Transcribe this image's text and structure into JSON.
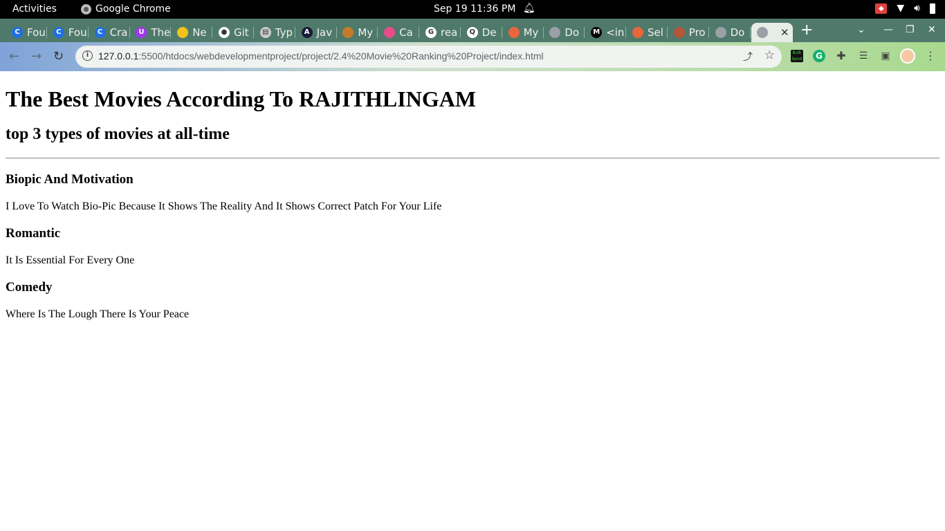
{
  "system_bar": {
    "activities": "Activities",
    "app_name": "Google Chrome",
    "datetime": "Sep 19  11:36 PM"
  },
  "tabs": [
    {
      "label": "Fou",
      "icon": "coursera-icon",
      "color": "#1f6fe5"
    },
    {
      "label": "Fou",
      "icon": "coursera-icon",
      "color": "#1f6fe5"
    },
    {
      "label": "Cra",
      "icon": "coursera-icon",
      "color": "#1f6fe5"
    },
    {
      "label": "The",
      "icon": "udemy-icon",
      "color": "#a435f0"
    },
    {
      "label": "Ne",
      "icon": "site-icon",
      "color": "#f0c419"
    },
    {
      "label": "Git",
      "icon": "github-icon",
      "color": "#ffffff"
    },
    {
      "label": "Typ",
      "icon": "document-icon",
      "color": "#cccccc"
    },
    {
      "label": "Jav",
      "icon": "angular-icon",
      "color": "#1a1a3a"
    },
    {
      "label": "My",
      "icon": "site-icon",
      "color": "#c77b2a"
    },
    {
      "label": "Ca",
      "icon": "site-icon",
      "color": "#e84c8a"
    },
    {
      "label": "rea",
      "icon": "google-icon",
      "color": "#ffffff"
    },
    {
      "label": "De",
      "icon": "search-site-icon",
      "color": "#ffffff"
    },
    {
      "label": "My",
      "icon": "site-icon",
      "color": "#e8663b"
    },
    {
      "label": "Do",
      "icon": "globe-icon",
      "color": "#9aa0a6"
    },
    {
      "label": "<in",
      "icon": "medium-icon",
      "color": "#000000"
    },
    {
      "label": "Sel",
      "icon": "site-icon",
      "color": "#e8663b"
    },
    {
      "label": "Pro",
      "icon": "site-icon",
      "color": "#b5553a"
    },
    {
      "label": "Do",
      "icon": "globe-icon",
      "color": "#9aa0a6"
    }
  ],
  "active_tab": {
    "label": "",
    "icon": "globe-icon"
  },
  "address_bar": {
    "host": "127.0.0.1",
    "path": ":5500/htdocs/webdevelopmentproject/project/2.4%20Movie%20Ranking%20Project/index.html"
  },
  "extensions": {
    "bulk_label": "Bulk Send"
  },
  "page": {
    "title": "The Best Movies According To RAJITHLINGAM",
    "subtitle": "top 3 types of movies at all-time",
    "sections": [
      {
        "heading": "Biopic And Motivation",
        "text": "I Love To Watch Bio-Pic Because It Shows The Reality And It Shows Correct Patch For Your Life"
      },
      {
        "heading": "Romantic",
        "text": "It Is Essential For Every One"
      },
      {
        "heading": "Comedy",
        "text": "Where Is The Lough There Is Your Peace"
      }
    ]
  }
}
